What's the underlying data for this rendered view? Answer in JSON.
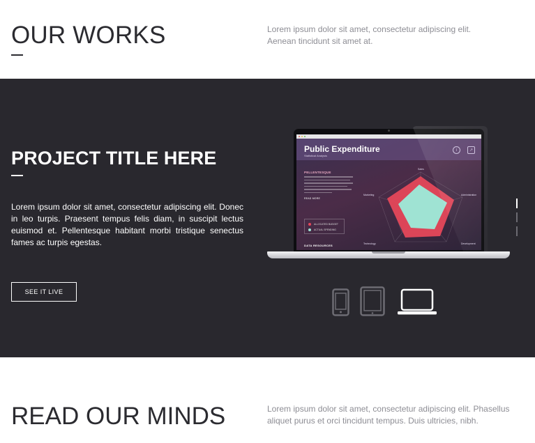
{
  "works": {
    "title": "OUR WORKS",
    "description": "Lorem ipsum dolor sit amet, consectetur adipiscing elit. Aenean tincidunt sit amet at."
  },
  "project": {
    "title": "PROJECT TITLE HERE",
    "description": "Lorem ipsum dolor sit amet, consectetur adipiscing elit. Donec in leo turpis. Praesent tempus felis diam, in suscipit lectus euismod et. Pellentesque habitant morbi tristique senectus fames ac turpis egestas.",
    "cta_label": "SEE IT LIVE",
    "slides": {
      "count": 3,
      "active": 1
    },
    "devices": [
      {
        "name": "phone",
        "active": false
      },
      {
        "name": "tablet",
        "active": false
      },
      {
        "name": "laptop",
        "active": true
      }
    ],
    "screen": {
      "title": "Public Expenditure",
      "subtitle": "Statistical Analysis",
      "section_title": "PELLENTESQUE",
      "read_more": "READ MORE",
      "legend": [
        "ALLOCATED BUDGET",
        "ACTUAL SPENDING"
      ],
      "footer": "DATA RESOURCES",
      "axes": [
        "Sales",
        "Administration",
        "Development",
        "Technology",
        "Marketing"
      ],
      "colors": {
        "budget": "#e5475a",
        "spending": "#9fe3d3"
      }
    }
  },
  "minds": {
    "title": "READ OUR MINDS",
    "description": "Lorem ipsum dolor sit amet, consectetur adipiscing elit. Phasellus aliquet purus et orci tincidunt tempus. Duis ultricies, nibh."
  }
}
